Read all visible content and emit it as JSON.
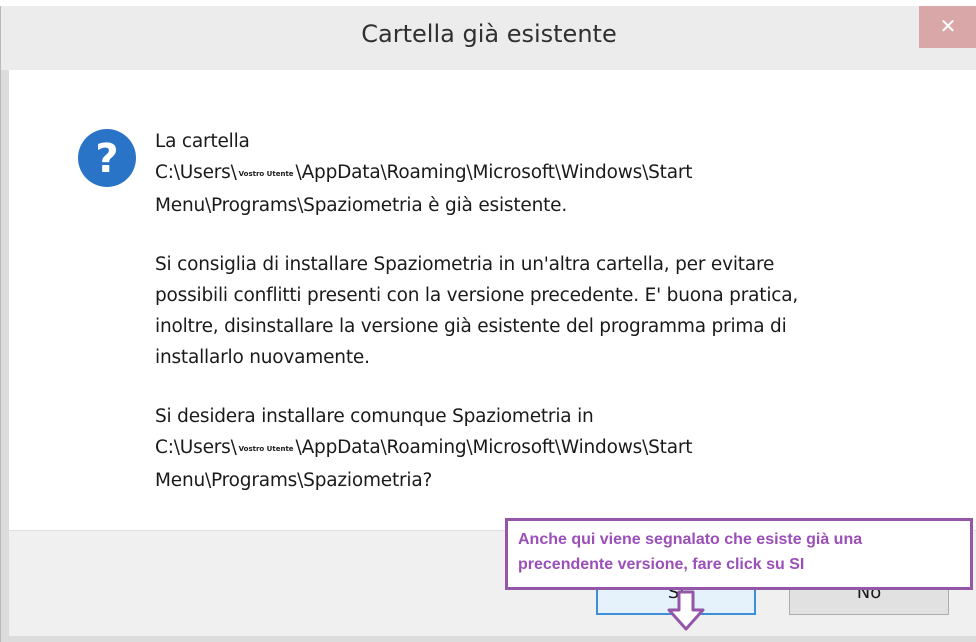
{
  "dialog": {
    "title": "Cartella già esistente",
    "close_glyph": "✕",
    "icon": "question-icon",
    "message": {
      "p1_line1": "La cartella",
      "p1_line2_pre": "C:\\Users\\",
      "p1_line2_user": "Vostro Utente",
      "p1_line2_post": "\\AppData\\Roaming\\Microsoft\\Windows\\Start",
      "p1_line3": "Menu\\Programs\\Spaziometria è già esistente.",
      "p2_line1": "Si consiglia di installare Spaziometria in un'altra cartella, per evitare",
      "p2_line2": "possibili conflitti presenti con la versione precedente. E' buona pratica,",
      "p2_line3": "inoltre, disinstallare la versione già esistente del programma prima di",
      "p2_line4": "installarlo nuovamente.",
      "p3_line1": "Si desidera installare comunque Spaziometria in",
      "p3_line2_pre": "C:\\Users\\",
      "p3_line2_user": "Vostro Utente",
      "p3_line2_post": "\\AppData\\Roaming\\Microsoft\\Windows\\Start",
      "p3_line3": "Menu\\Programs\\Spaziometria?"
    },
    "buttons": {
      "yes_label": "Sì",
      "no_label": "No"
    }
  },
  "annotation": {
    "line1": "Anche qui viene segnalato che esiste già una",
    "line2": "precendente versione, fare click su SI",
    "color": "#9b4fb8"
  },
  "colors": {
    "accent": "#3c8fd8",
    "icon_blue": "#2a74c8",
    "close_red": "#d9a7a7"
  }
}
